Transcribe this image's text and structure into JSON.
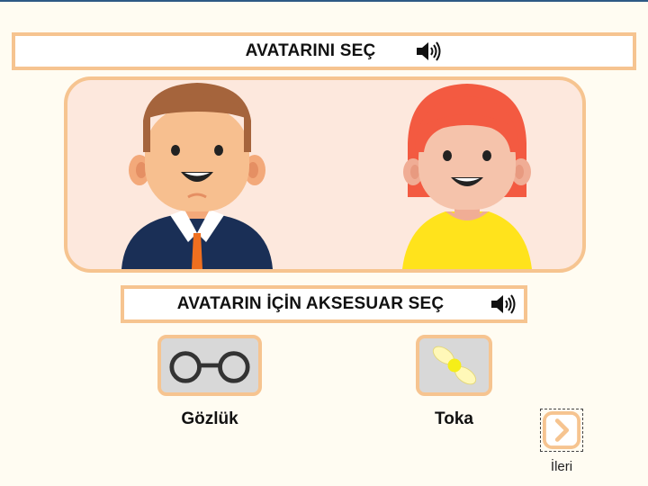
{
  "header": {
    "title": "AVATARINI SEÇ",
    "speaker_icon": "speaker-icon"
  },
  "avatars": {
    "items": [
      {
        "name": "boy-avatar",
        "hair_color": "#a5643c",
        "skin_color": "#f7bf8f",
        "suit_color": "#1a2f56",
        "tie_color": "#ef6f1f"
      },
      {
        "name": "girl-avatar",
        "hair_color": "#f35a41",
        "skin_color": "#f5c3ab",
        "shirt_color": "#ffe31c"
      }
    ],
    "panel_color": "#fde8dd",
    "border_color": "#f6c490"
  },
  "accessory_section": {
    "title": "AVATARIN İÇİN AKSESUAR SEÇ",
    "items": [
      {
        "label": "Gözlük",
        "icon": "glasses-icon"
      },
      {
        "label": "Toka",
        "icon": "hair-clip-icon"
      }
    ]
  },
  "navigation": {
    "next_label": "İleri",
    "next_icon": "chevron-right-icon",
    "accent": "#f6c490"
  }
}
